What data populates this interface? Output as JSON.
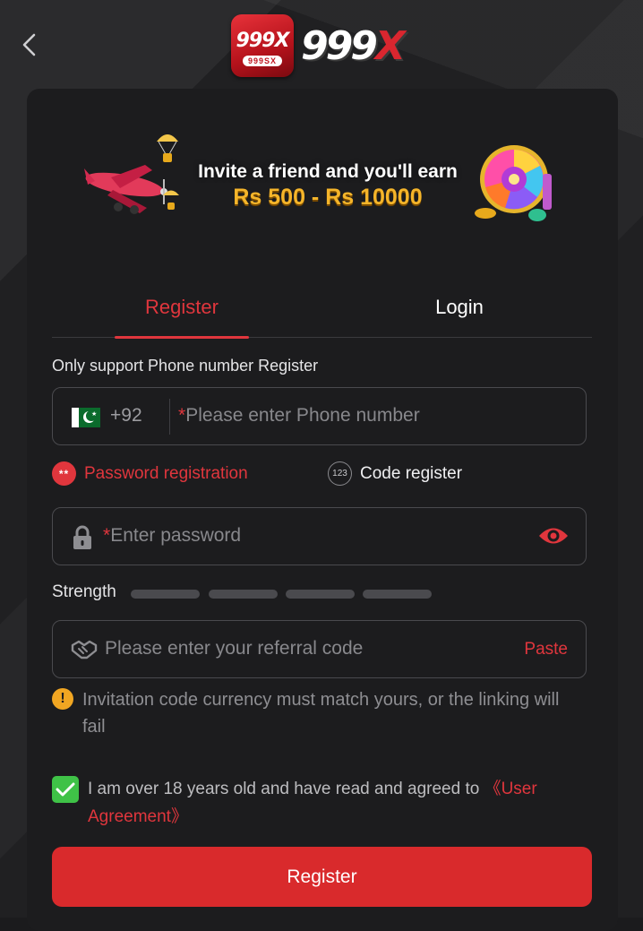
{
  "header": {
    "app_icon_text": "999X",
    "app_icon_subtext": "999SX",
    "brand_logo_main": "999",
    "brand_logo_x": "X"
  },
  "banner": {
    "line1": "Invite a friend and you'll earn",
    "line2": "Rs 500 - Rs 10000"
  },
  "tabs": {
    "register": "Register",
    "login": "Login",
    "active": "register"
  },
  "form": {
    "hint": "Only support Phone number Register",
    "phone": {
      "country_code": "+92",
      "required_mark": "*",
      "placeholder": "Please enter Phone number"
    },
    "modes": {
      "password_label": "Password registration",
      "password_icon": "**",
      "code_label": "Code register",
      "code_icon": "123",
      "selected": "password"
    },
    "password": {
      "required_mark": "*",
      "placeholder": "Enter password"
    },
    "strength": {
      "label": "Strength",
      "level": 0,
      "segments": 4
    },
    "referral": {
      "placeholder": "Please enter your referral code",
      "paste_label": "Paste"
    },
    "warning": "Invitation code currency must match yours, or the linking will fail",
    "agreement": {
      "checked": true,
      "text": "I am over 18 years old and have read and agreed to ",
      "link": "《User Agreement》"
    },
    "submit_label": "Register"
  },
  "colors": {
    "accent": "#e0363d",
    "button": "#d92a2c",
    "check": "#3fc247",
    "warning": "#f1a622",
    "card": "#1c1c1e"
  },
  "icons": [
    "back-arrow-icon",
    "pakistan-flag-icon",
    "lock-icon",
    "eye-icon",
    "handshake-icon",
    "warning-icon",
    "checkmark-icon"
  ]
}
